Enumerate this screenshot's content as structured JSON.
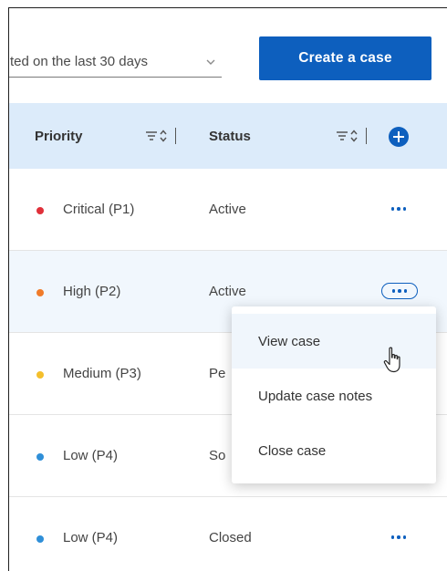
{
  "toolbar": {
    "filter_value": "ted on the last 30 days",
    "create_label": "Create a case"
  },
  "table": {
    "columns": [
      {
        "label": "Priority"
      },
      {
        "label": "Status"
      }
    ],
    "rows": [
      {
        "priority": "Critical (P1)",
        "priority_color": "#e0303a",
        "status": "Active"
      },
      {
        "priority": "High (P2)",
        "priority_color": "#f07b2a",
        "status": "Active"
      },
      {
        "priority": "Medium (P3)",
        "priority_color": "#f4bf2c",
        "status": "Pe"
      },
      {
        "priority": "Low (P4)",
        "priority_color": "#2f8fd8",
        "status": "So"
      },
      {
        "priority": "Low (P4)",
        "priority_color": "#2f8fd8",
        "status": "Closed"
      }
    ]
  },
  "row_menu": {
    "items": [
      {
        "label": "View case"
      },
      {
        "label": "Update case notes"
      },
      {
        "label": "Close case"
      }
    ]
  },
  "colors": {
    "accent": "#0d5fbe",
    "header_bg": "#dcebfa"
  }
}
